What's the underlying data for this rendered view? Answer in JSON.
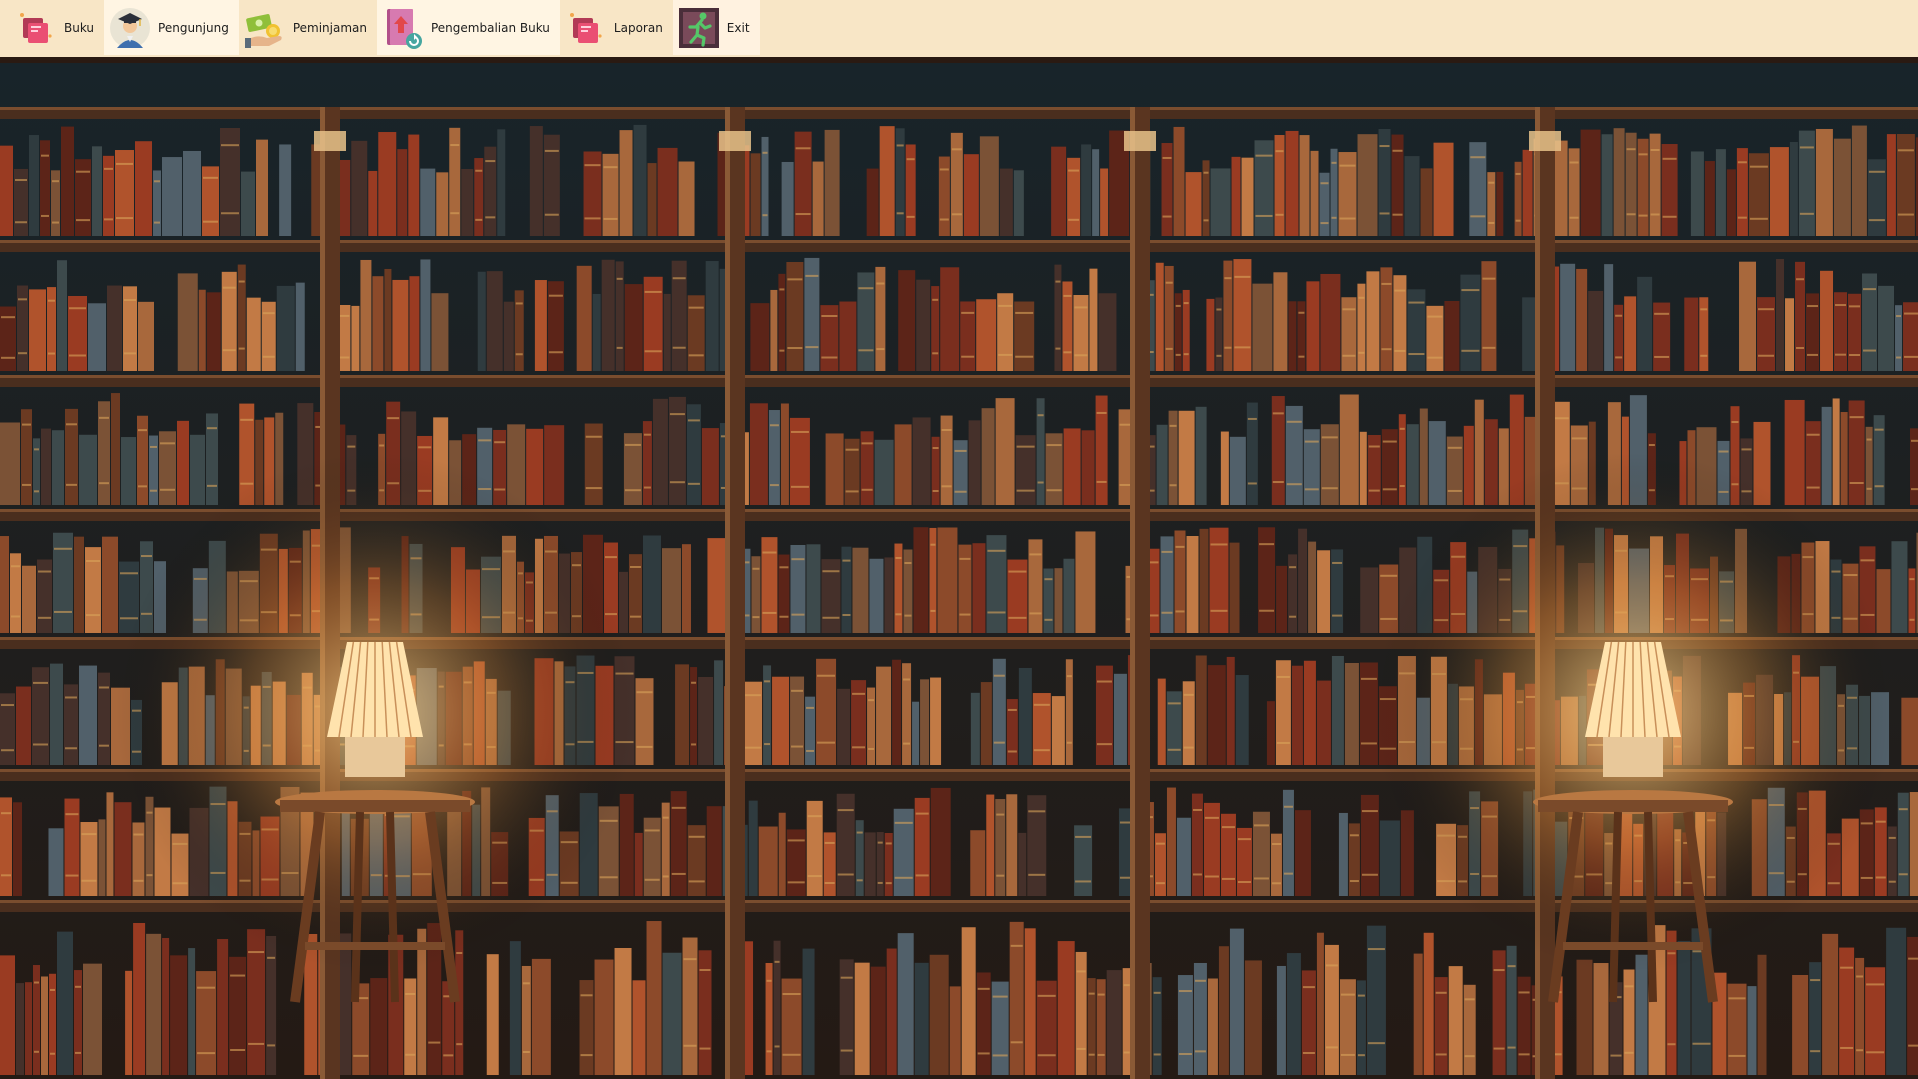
{
  "toolbar": {
    "items": [
      {
        "label": "Buku",
        "icon": "book-stack-icon",
        "color": "#e24a6b"
      },
      {
        "label": "Pengunjung",
        "icon": "graduate-visitor-icon",
        "color": "#3f6fae"
      },
      {
        "label": "Peminjaman",
        "icon": "money-hand-icon",
        "color": "#8fbf3a"
      },
      {
        "label": "Pengembalian Buku",
        "icon": "book-return-icon",
        "color": "#b2508a"
      },
      {
        "label": "Laporan",
        "icon": "report-book-icon",
        "color": "#e24a6b"
      },
      {
        "label": "Exit",
        "icon": "exit-running-man-icon",
        "color": "#3fae55"
      }
    ],
    "background": "#f8e6c6"
  },
  "background_image": {
    "subject": "library bookshelf wallpaper with two glowing table lamps"
  }
}
